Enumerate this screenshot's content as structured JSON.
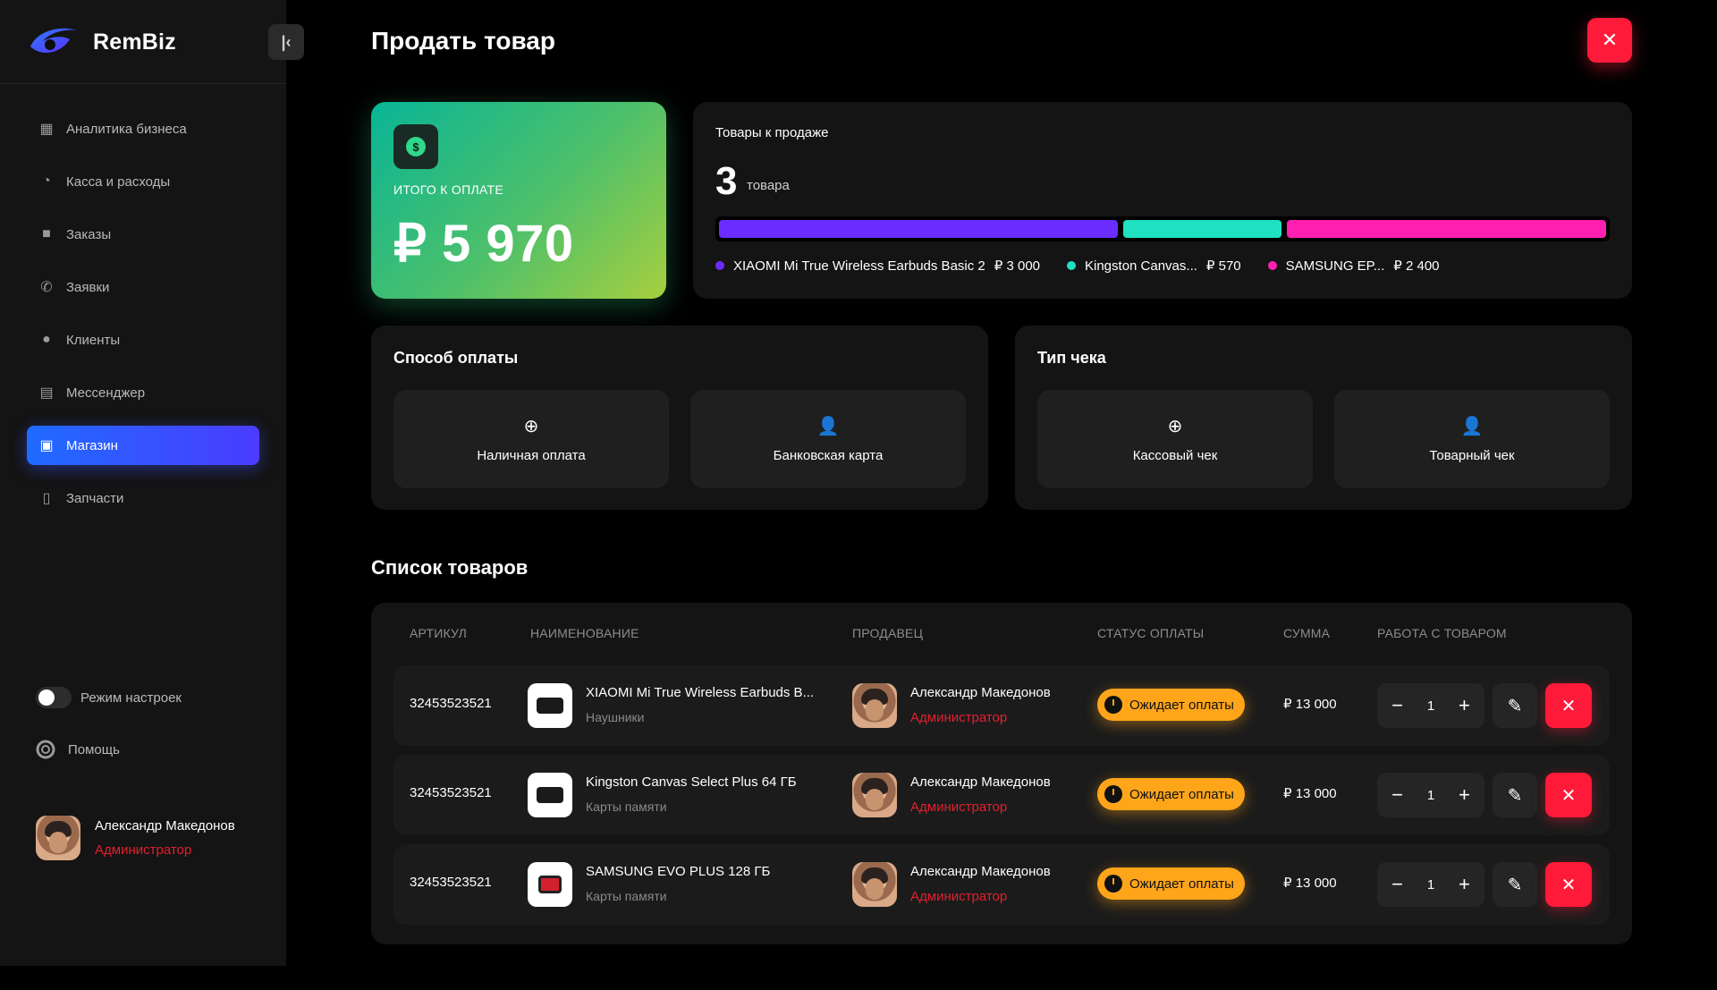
{
  "app": {
    "name": "RemBiz",
    "colors": {
      "accent": "#3a4dff",
      "danger": "#ff1a3a",
      "warning": "#ffa51a",
      "success_start": "#08b596",
      "success_end": "#a7cf3e"
    }
  },
  "sidebar": {
    "items": [
      {
        "label": "Аналитика бизнеса",
        "icon": "dashboard-icon"
      },
      {
        "label": "Касса и расходы",
        "icon": "pie-chart-icon"
      },
      {
        "label": "Заказы",
        "icon": "briefcase-icon"
      },
      {
        "label": "Заявки",
        "icon": "phone-icon"
      },
      {
        "label": "Клиенты",
        "icon": "person-icon"
      },
      {
        "label": "Мессенджер",
        "icon": "chat-icon"
      },
      {
        "label": "Магазин",
        "icon": "shopping-bag-icon",
        "active": true
      },
      {
        "label": "Запчасти",
        "icon": "device-icon"
      }
    ],
    "settings_mode": "Режим настроек",
    "help": "Помощь",
    "user": {
      "name": "Александр Македонов",
      "role": "Администратор"
    }
  },
  "main": {
    "title": "Продать товар",
    "total": {
      "label": "ИТОГО К ОПЛАТЕ",
      "amount": "₽ 5 970"
    },
    "goods": {
      "title": "Товары к продаже",
      "count": "3",
      "unit": "товара",
      "items": [
        {
          "name": "XIAOMI Mi True Wireless Earbuds Basic 2",
          "price": "₽ 3 000",
          "value": 3000,
          "color": "#6a2cff"
        },
        {
          "name": "Kingston Canvas...",
          "price": "₽ 570",
          "value": 570,
          "color": "#1fe0c0"
        },
        {
          "name": "SAMSUNG EP...",
          "price": "₽ 2 400",
          "value": 2400,
          "color": "#ff1fb0"
        }
      ]
    },
    "payment": {
      "title": "Способ оплаты",
      "options": [
        {
          "label": "Наличная оплата",
          "icon": "plus-circle-icon"
        },
        {
          "label": "Банковская карта",
          "icon": "user-check-icon"
        }
      ]
    },
    "receipt": {
      "title": "Тип чека",
      "options": [
        {
          "label": "Кассовый чек",
          "icon": "plus-circle-icon"
        },
        {
          "label": "Товарный чек",
          "icon": "user-check-icon"
        }
      ]
    },
    "list": {
      "title": "Список товаров",
      "columns": [
        "АРТИКУЛ",
        "НАИМЕНОВАНИЕ",
        "ПРОДАВЕЦ",
        "СТАТУС ОПЛАТЫ",
        "СУММА",
        "РАБОТА С ТОВАРОМ"
      ],
      "rows": [
        {
          "sku": "32453523521",
          "name": "XIAOMI Mi True Wireless Earbuds B...",
          "category": "Наушники",
          "seller": "Александр Македонов",
          "seller_role": "Администратор",
          "status": "Ожидает оплаты",
          "sum": "₽ 13 000",
          "qty": "1"
        },
        {
          "sku": "32453523521",
          "name": "Kingston Canvas Select Plus 64 ГБ",
          "category": "Карты памяти",
          "seller": "Александр Македонов",
          "seller_role": "Администратор",
          "status": "Ожидает оплаты",
          "sum": "₽ 13 000",
          "qty": "1"
        },
        {
          "sku": "32453523521",
          "name": "SAMSUNG EVO PLUS 128 ГБ",
          "category": "Карты памяти",
          "seller": "Александр Македонов",
          "seller_role": "Администратор",
          "status": "Ожидает оплаты",
          "sum": "₽ 13 000",
          "qty": "1"
        }
      ]
    }
  }
}
